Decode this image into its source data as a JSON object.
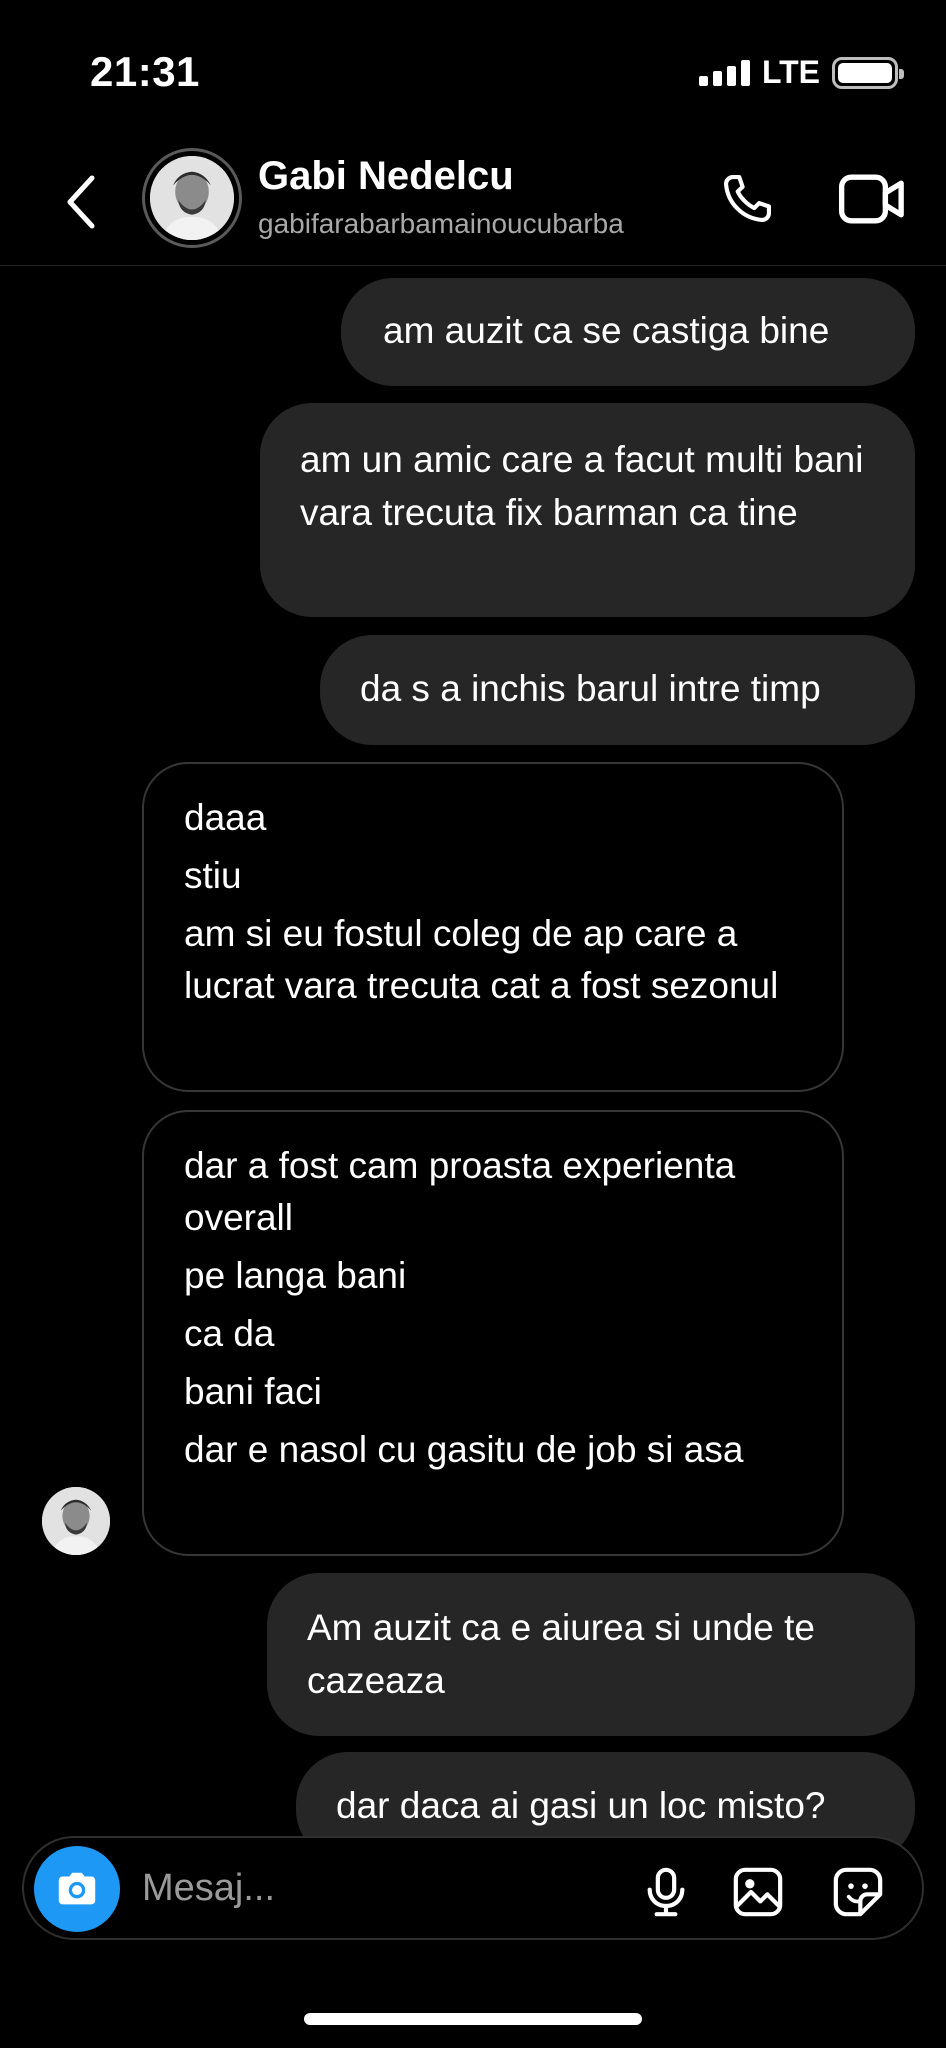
{
  "status_bar": {
    "time": "21:31",
    "network": "LTE"
  },
  "header": {
    "contact_name": "Gabi Nedelcu",
    "username": "gabifarabarbamainoucubarba",
    "icons": [
      "back-chevron-icon",
      "phone-icon",
      "video-camera-icon"
    ]
  },
  "messages": [
    {
      "from": "me",
      "text": "am auzit ca se castiga bine"
    },
    {
      "from": "me",
      "text": "am un amic care a facut multi bani vara trecuta fix barman ca tine"
    },
    {
      "from": "me",
      "text": "da s a inchis barul intre timp"
    },
    {
      "from": "them",
      "lines": [
        "daaa",
        "stiu",
        "am si eu fostul coleg de ap care a lucrat vara trecuta cat a fost sezonul"
      ]
    },
    {
      "from": "them",
      "lines": [
        "dar a fost cam proasta experienta overall",
        "pe langa bani",
        "ca da",
        "bani faci",
        "dar e nasol cu gasitu de job si asa"
      ]
    },
    {
      "from": "me",
      "text": "Am auzit ca e aiurea si unde te cazeaza"
    },
    {
      "from": "me",
      "text": "dar daca ai gasi un loc misto?"
    }
  ],
  "composer": {
    "placeholder": "Mesaj...",
    "icons": [
      "camera-icon",
      "microphone-icon",
      "gallery-icon",
      "sticker-icon"
    ]
  },
  "colors": {
    "accent": "#1d98f5",
    "sent_bubble": "#262626",
    "background": "#000000"
  }
}
